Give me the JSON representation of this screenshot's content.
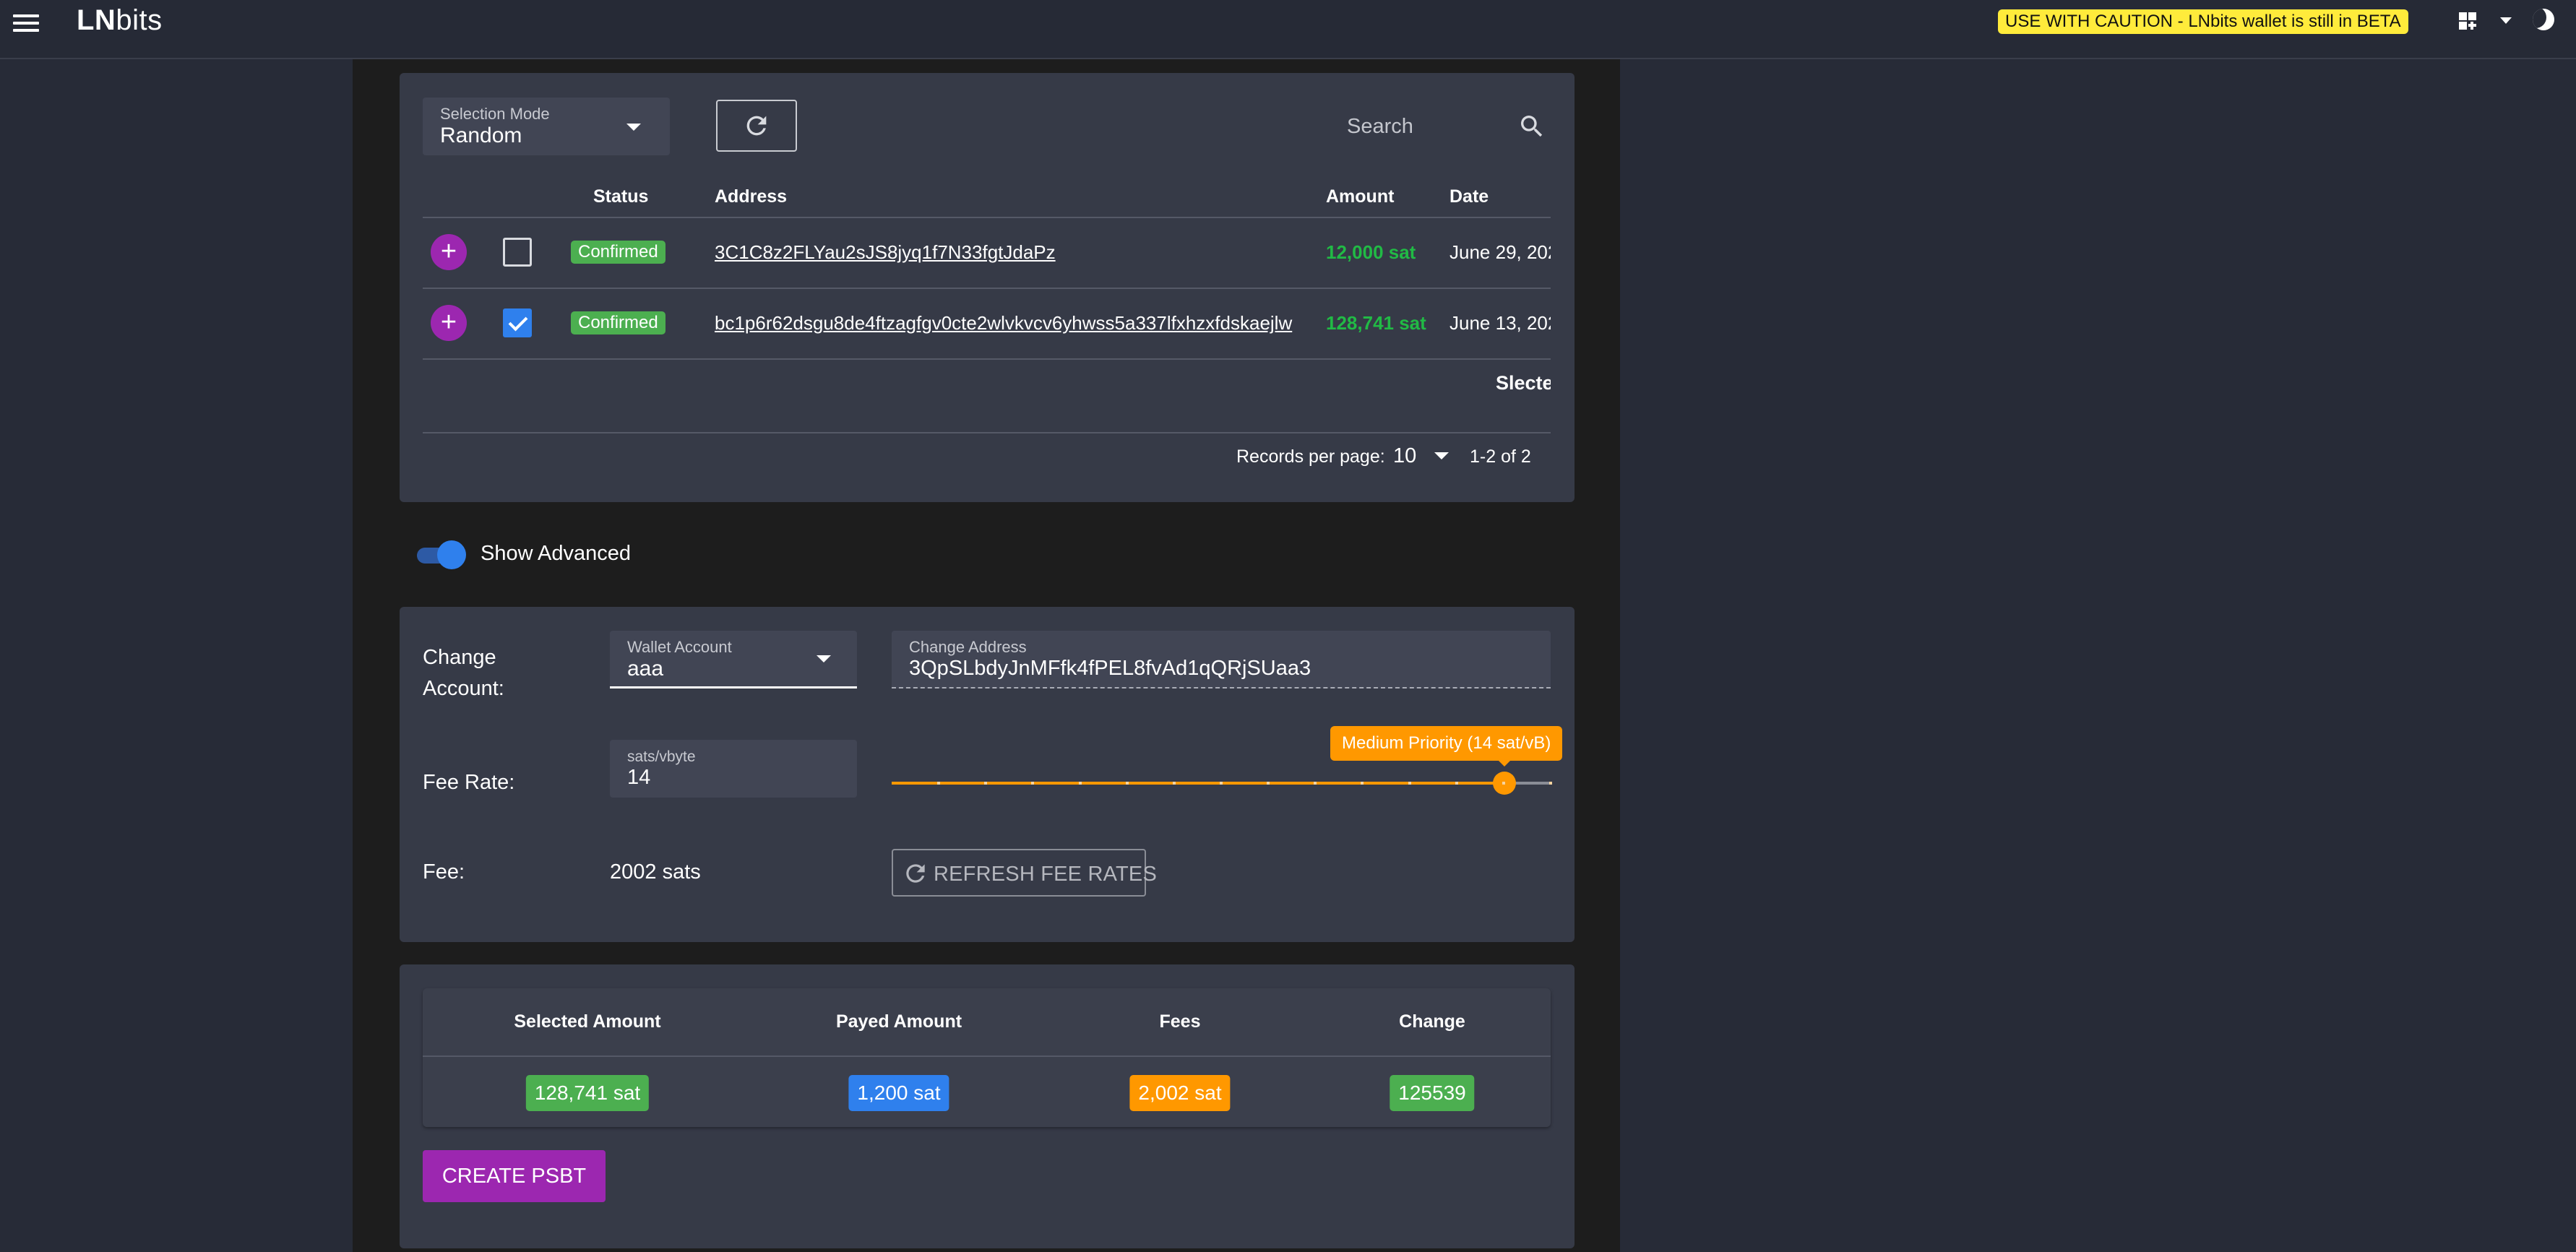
{
  "header": {
    "logo_bold": "LN",
    "logo_rest": "bits",
    "beta_notice": "USE WITH CAUTION - LNbits wallet is still in BETA"
  },
  "utxo": {
    "selection_mode_label": "Selection Mode",
    "selection_mode_value": "Random",
    "search_placeholder": "Search",
    "columns": [
      "Status",
      "Address",
      "Amount",
      "Date"
    ],
    "rows": [
      {
        "status": "Confirmed",
        "address": "3C1C8z2FLYau2sJS8jyq1f7N33fgtJdaPz",
        "amount": "12,000 sat",
        "date": "June 29, 202",
        "selected": false
      },
      {
        "status": "Confirmed",
        "address": "bc1p6r62dsgu8de4ftzagfgv0cte2wlvkvcv6yhwss5a337lfxhzxfdskaejlw",
        "amount": "128,741 sat",
        "date": "June 13, 202",
        "selected": true
      }
    ],
    "selected_footer": "Slecte",
    "records_per_page_label": "Records per page:",
    "records_per_page_value": "10",
    "range": "1-2 of 2"
  },
  "advanced": {
    "toggle_label": "Show Advanced",
    "toggle_on": true,
    "change_account_label": "Change Account:",
    "wallet_account_label": "Wallet Account",
    "wallet_account_value": "aaa",
    "change_address_label": "Change Address",
    "change_address_value": "3QpSLbdyJnMFfk4fPEL8fvAd1qQRjSUaa3",
    "fee_rate_label": "Fee Rate:",
    "fee_rate_unit": "sats/vbyte",
    "fee_rate_value": "14",
    "slider_fraction": 0.93,
    "slider_tooltip": "Medium Priority (14 sat/vB)",
    "fee_label": "Fee:",
    "fee_value": "2002 sats",
    "refresh_fee_label": "REFRESH FEE RATES"
  },
  "summary": {
    "columns": [
      "Selected Amount",
      "Payed Amount",
      "Fees",
      "Change"
    ],
    "values": [
      "128,741 sat",
      "1,200 sat",
      "2,002 sat",
      "125539"
    ],
    "badge_colors": [
      "#4caf50",
      "#2f80ed",
      "#ff9800",
      "#4caf50"
    ],
    "create_label": "CREATE PSBT"
  },
  "colors": {
    "accent_purple": "#9c27b0",
    "positive_green": "#21ba45",
    "warning_orange": "#ff9800",
    "primary_blue": "#2f80ed",
    "beta_yellow": "#ffeb3b"
  },
  "icons": [
    "menu-icon",
    "apps-icon",
    "chevron-down-icon",
    "moon-icon",
    "refresh-icon",
    "search-icon",
    "add-icon",
    "checkbox-icon"
  ]
}
